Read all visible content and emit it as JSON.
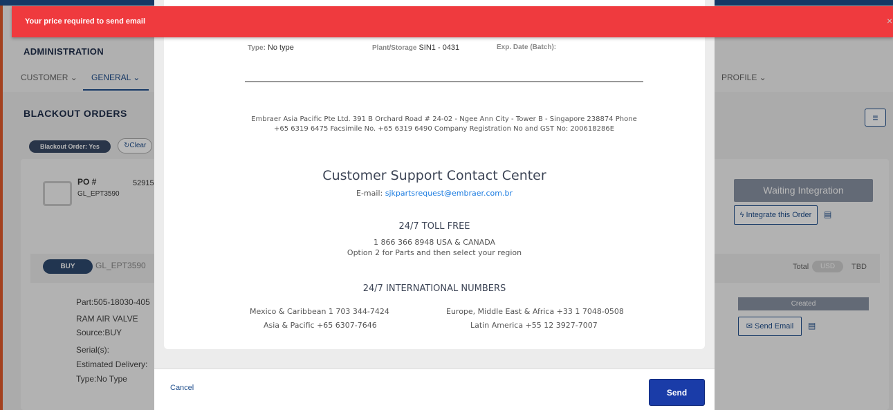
{
  "toast": {
    "message": "Your price required to send email",
    "close_icon": "×"
  },
  "background": {
    "app_title": "ADMINISTRATION",
    "nav": [
      {
        "label": "CUSTOMER ⌄"
      },
      {
        "label": "GENERAL ⌄"
      },
      {
        "label": "PROFILE ⌄"
      }
    ],
    "section_title": "BLACKOUT ORDERS",
    "filter_icon": "≡",
    "filter_chip": "Blackout Order: Yes",
    "clear_label": "↻Clear",
    "po_label": "PO #",
    "po_sub": "GL_EPT3590",
    "po_number": "52915",
    "waiting_label": "Waiting Integration",
    "integrate_label": "Integrate this Order",
    "buy_label": "BUY",
    "buy_po": "GL_EPT3590",
    "total_label": "Total",
    "currency": "USD",
    "total_value": "TBD",
    "part_label": "Part:505-18030-405",
    "part_name": "RAM AIR VALVE",
    "source_label": "Source:BUY",
    "serials_label": "Serial(s):",
    "delivery_label": "Estimated Delivery:",
    "type_label": "Type:No Type",
    "status_label": "Created",
    "send_email_label": "Send Email"
  },
  "modal": {
    "type_label": "Type:",
    "type_value": "No type",
    "plant_label": "Plant/Storage",
    "plant_value": "SIN1 - 0431",
    "exp_label": "Exp. Date (Batch):",
    "company_info": "Embraer Asia Pacific Pte Ltd. 391 B Orchard Road # 24-02 - Ngee Ann City - Tower B - Singapore 238874 Phone +65 6319 6475 Facsimile No. +65 6319 6490 Company Registration No and GST No: 200618286E",
    "support_title": "Customer Support Contact Center",
    "email_label": "E-mail:",
    "email_value": "sjkpartsrequest@embraer.com.br",
    "toll_free_title": "24/7 TOLL FREE",
    "toll_free_line1": "1 866 366 8948 USA & CANADA",
    "toll_free_line2": "Option 2 for Parts and then select your region",
    "intl_title": "24/7 INTERNATIONAL NUMBERS",
    "intl": {
      "mexico": "Mexico & Caribbean 1 703 344-7424",
      "asia": "Asia & Pacific +65 6307-7646",
      "europe": "Europe, Middle East & Africa +33 1 7048-0508",
      "latam": "Latin America +55 12 3927-7007"
    },
    "cancel_label": "Cancel",
    "send_label": "Send"
  }
}
